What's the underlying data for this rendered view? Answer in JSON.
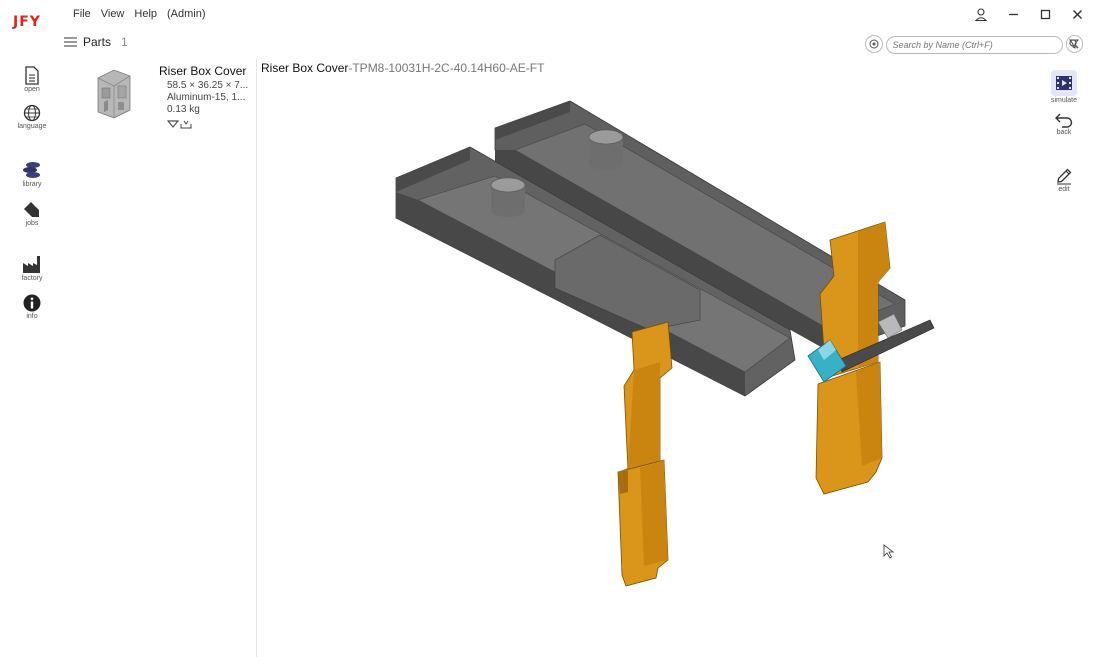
{
  "app": {
    "logo": "JFY"
  },
  "menu": {
    "file": "File",
    "view": "View",
    "help": "Help",
    "role": "(Admin)"
  },
  "rail": {
    "open": "open",
    "language": "language",
    "library": "library",
    "jobs": "jobs",
    "factory": "factory",
    "info": "info"
  },
  "parts": {
    "title": "Parts",
    "count": "1",
    "item": {
      "name": "Riser Box Cover",
      "dims": "58.5 × 36.25 × 7...",
      "material": "Aluminum-15, 1...",
      "mass": "0.13 kg"
    }
  },
  "viewer": {
    "title": "Riser Box Cover",
    "subtitle": "-TPM8-10031H-2C-40.14H60-AE-FT"
  },
  "search": {
    "placeholder_prefix": "Search by ",
    "placeholder_bold": "Name",
    "placeholder_suffix": " (Ctrl+F)"
  },
  "tools": {
    "simulate": "simulate",
    "back": "back",
    "edit": "edit"
  },
  "colors": {
    "brand": "#e2231a",
    "tool_orange": "#d9961a",
    "tool_grey": "#6b6b6b",
    "part_teal": "#3ab0c6",
    "simulate_bg": "#e3e6f6"
  }
}
